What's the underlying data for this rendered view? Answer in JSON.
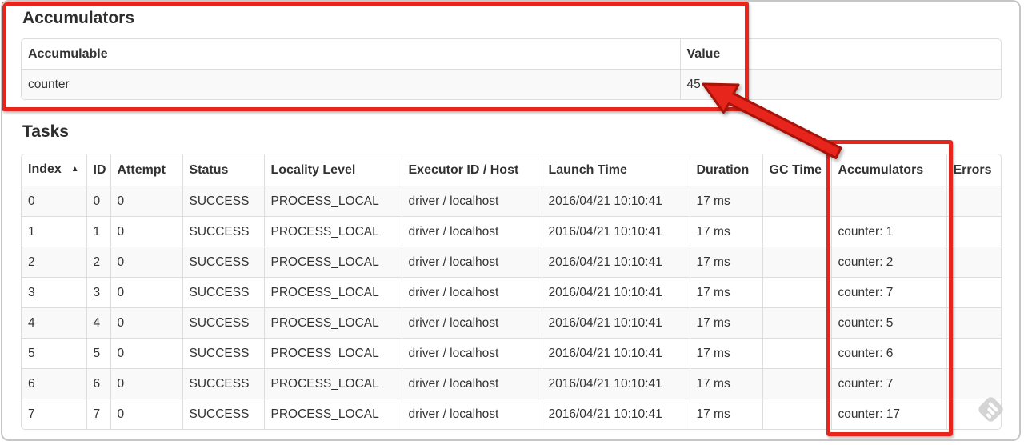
{
  "theme": {
    "annotation_red": "#e8251c",
    "annotation_red_outline": "#a81208",
    "text_color": "#333333",
    "table_border_color": "#dddddd",
    "row_stripe_color": "#f9f9f9",
    "window_border_color": "#c6c6c6"
  },
  "accumulators_section": {
    "title": "Accumulators",
    "columns": [
      "Accumulable",
      "Value"
    ],
    "rows": [
      [
        "counter",
        "45"
      ]
    ]
  },
  "tasks_section": {
    "title": "Tasks",
    "sort_indicator": "▲",
    "columns": [
      "Index",
      "ID",
      "Attempt",
      "Status",
      "Locality Level",
      "Executor ID / Host",
      "Launch Time",
      "Duration",
      "GC Time",
      "Accumulators",
      "Errors"
    ],
    "rows": [
      [
        "0",
        "0",
        "0",
        "SUCCESS",
        "PROCESS_LOCAL",
        "driver / localhost",
        "2016/04/21 10:10:41",
        "17 ms",
        "",
        "",
        ""
      ],
      [
        "1",
        "1",
        "0",
        "SUCCESS",
        "PROCESS_LOCAL",
        "driver / localhost",
        "2016/04/21 10:10:41",
        "17 ms",
        "",
        "counter: 1",
        ""
      ],
      [
        "2",
        "2",
        "0",
        "SUCCESS",
        "PROCESS_LOCAL",
        "driver / localhost",
        "2016/04/21 10:10:41",
        "17 ms",
        "",
        "counter: 2",
        ""
      ],
      [
        "3",
        "3",
        "0",
        "SUCCESS",
        "PROCESS_LOCAL",
        "driver / localhost",
        "2016/04/21 10:10:41",
        "17 ms",
        "",
        "counter: 7",
        ""
      ],
      [
        "4",
        "4",
        "0",
        "SUCCESS",
        "PROCESS_LOCAL",
        "driver / localhost",
        "2016/04/21 10:10:41",
        "17 ms",
        "",
        "counter: 5",
        ""
      ],
      [
        "5",
        "5",
        "0",
        "SUCCESS",
        "PROCESS_LOCAL",
        "driver / localhost",
        "2016/04/21 10:10:41",
        "17 ms",
        "",
        "counter: 6",
        ""
      ],
      [
        "6",
        "6",
        "0",
        "SUCCESS",
        "PROCESS_LOCAL",
        "driver / localhost",
        "2016/04/21 10:10:41",
        "17 ms",
        "",
        "counter: 7",
        ""
      ],
      [
        "7",
        "7",
        "0",
        "SUCCESS",
        "PROCESS_LOCAL",
        "driver / localhost",
        "2016/04/21 10:10:41",
        "17 ms",
        "",
        "counter: 17",
        ""
      ]
    ]
  }
}
